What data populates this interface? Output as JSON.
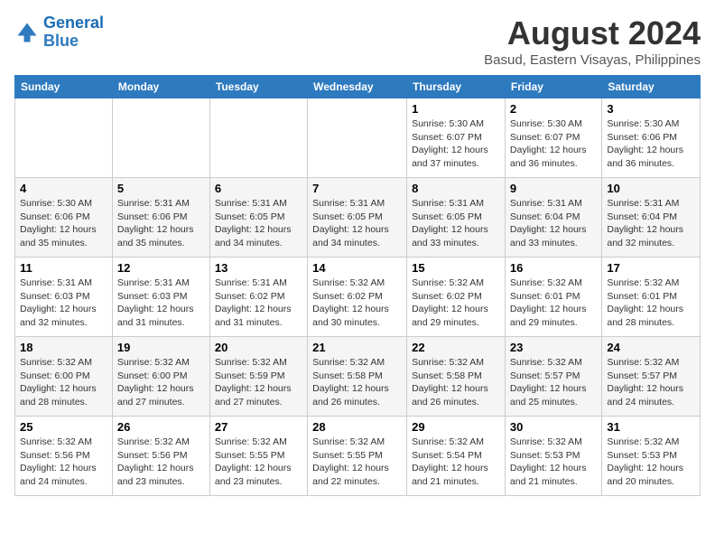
{
  "logo": {
    "line1": "General",
    "line2": "Blue"
  },
  "title": "August 2024",
  "subtitle": "Basud, Eastern Visayas, Philippines",
  "weekdays": [
    "Sunday",
    "Monday",
    "Tuesday",
    "Wednesday",
    "Thursday",
    "Friday",
    "Saturday"
  ],
  "weeks": [
    [
      {
        "day": "",
        "info": ""
      },
      {
        "day": "",
        "info": ""
      },
      {
        "day": "",
        "info": ""
      },
      {
        "day": "",
        "info": ""
      },
      {
        "day": "1",
        "info": "Sunrise: 5:30 AM\nSunset: 6:07 PM\nDaylight: 12 hours\nand 37 minutes."
      },
      {
        "day": "2",
        "info": "Sunrise: 5:30 AM\nSunset: 6:07 PM\nDaylight: 12 hours\nand 36 minutes."
      },
      {
        "day": "3",
        "info": "Sunrise: 5:30 AM\nSunset: 6:06 PM\nDaylight: 12 hours\nand 36 minutes."
      }
    ],
    [
      {
        "day": "4",
        "info": "Sunrise: 5:30 AM\nSunset: 6:06 PM\nDaylight: 12 hours\nand 35 minutes."
      },
      {
        "day": "5",
        "info": "Sunrise: 5:31 AM\nSunset: 6:06 PM\nDaylight: 12 hours\nand 35 minutes."
      },
      {
        "day": "6",
        "info": "Sunrise: 5:31 AM\nSunset: 6:05 PM\nDaylight: 12 hours\nand 34 minutes."
      },
      {
        "day": "7",
        "info": "Sunrise: 5:31 AM\nSunset: 6:05 PM\nDaylight: 12 hours\nand 34 minutes."
      },
      {
        "day": "8",
        "info": "Sunrise: 5:31 AM\nSunset: 6:05 PM\nDaylight: 12 hours\nand 33 minutes."
      },
      {
        "day": "9",
        "info": "Sunrise: 5:31 AM\nSunset: 6:04 PM\nDaylight: 12 hours\nand 33 minutes."
      },
      {
        "day": "10",
        "info": "Sunrise: 5:31 AM\nSunset: 6:04 PM\nDaylight: 12 hours\nand 32 minutes."
      }
    ],
    [
      {
        "day": "11",
        "info": "Sunrise: 5:31 AM\nSunset: 6:03 PM\nDaylight: 12 hours\nand 32 minutes."
      },
      {
        "day": "12",
        "info": "Sunrise: 5:31 AM\nSunset: 6:03 PM\nDaylight: 12 hours\nand 31 minutes."
      },
      {
        "day": "13",
        "info": "Sunrise: 5:31 AM\nSunset: 6:02 PM\nDaylight: 12 hours\nand 31 minutes."
      },
      {
        "day": "14",
        "info": "Sunrise: 5:32 AM\nSunset: 6:02 PM\nDaylight: 12 hours\nand 30 minutes."
      },
      {
        "day": "15",
        "info": "Sunrise: 5:32 AM\nSunset: 6:02 PM\nDaylight: 12 hours\nand 29 minutes."
      },
      {
        "day": "16",
        "info": "Sunrise: 5:32 AM\nSunset: 6:01 PM\nDaylight: 12 hours\nand 29 minutes."
      },
      {
        "day": "17",
        "info": "Sunrise: 5:32 AM\nSunset: 6:01 PM\nDaylight: 12 hours\nand 28 minutes."
      }
    ],
    [
      {
        "day": "18",
        "info": "Sunrise: 5:32 AM\nSunset: 6:00 PM\nDaylight: 12 hours\nand 28 minutes."
      },
      {
        "day": "19",
        "info": "Sunrise: 5:32 AM\nSunset: 6:00 PM\nDaylight: 12 hours\nand 27 minutes."
      },
      {
        "day": "20",
        "info": "Sunrise: 5:32 AM\nSunset: 5:59 PM\nDaylight: 12 hours\nand 27 minutes."
      },
      {
        "day": "21",
        "info": "Sunrise: 5:32 AM\nSunset: 5:58 PM\nDaylight: 12 hours\nand 26 minutes."
      },
      {
        "day": "22",
        "info": "Sunrise: 5:32 AM\nSunset: 5:58 PM\nDaylight: 12 hours\nand 26 minutes."
      },
      {
        "day": "23",
        "info": "Sunrise: 5:32 AM\nSunset: 5:57 PM\nDaylight: 12 hours\nand 25 minutes."
      },
      {
        "day": "24",
        "info": "Sunrise: 5:32 AM\nSunset: 5:57 PM\nDaylight: 12 hours\nand 24 minutes."
      }
    ],
    [
      {
        "day": "25",
        "info": "Sunrise: 5:32 AM\nSunset: 5:56 PM\nDaylight: 12 hours\nand 24 minutes."
      },
      {
        "day": "26",
        "info": "Sunrise: 5:32 AM\nSunset: 5:56 PM\nDaylight: 12 hours\nand 23 minutes."
      },
      {
        "day": "27",
        "info": "Sunrise: 5:32 AM\nSunset: 5:55 PM\nDaylight: 12 hours\nand 23 minutes."
      },
      {
        "day": "28",
        "info": "Sunrise: 5:32 AM\nSunset: 5:55 PM\nDaylight: 12 hours\nand 22 minutes."
      },
      {
        "day": "29",
        "info": "Sunrise: 5:32 AM\nSunset: 5:54 PM\nDaylight: 12 hours\nand 21 minutes."
      },
      {
        "day": "30",
        "info": "Sunrise: 5:32 AM\nSunset: 5:53 PM\nDaylight: 12 hours\nand 21 minutes."
      },
      {
        "day": "31",
        "info": "Sunrise: 5:32 AM\nSunset: 5:53 PM\nDaylight: 12 hours\nand 20 minutes."
      }
    ]
  ]
}
